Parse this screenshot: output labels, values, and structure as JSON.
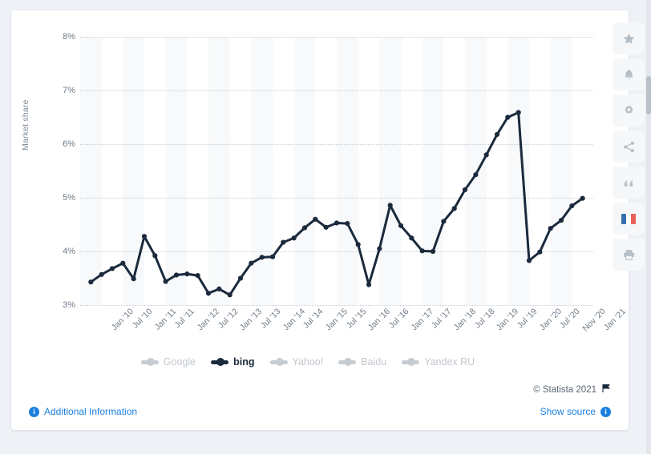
{
  "chart_data": {
    "type": "line",
    "title": "",
    "xlabel": "",
    "ylabel": "Market share",
    "ylim": [
      3,
      8
    ],
    "yticks": [
      "3%",
      "4%",
      "5%",
      "6%",
      "7%",
      "8%"
    ],
    "ytick_values": [
      3,
      4,
      5,
      6,
      7,
      8
    ],
    "grid": true,
    "legend_position": "bottom",
    "legend": [
      "Google",
      "bing",
      "Yahoo!",
      "Baidu",
      "Yandex RU"
    ],
    "active_series": "bing",
    "x_tick_labels": [
      "Jan '10",
      "Jul '10",
      "Jan '11",
      "Jul '11",
      "Jan '12",
      "Jul '12",
      "Jan '13",
      "Jul '13",
      "Jan '14",
      "Jul '14",
      "Jan '15",
      "Jul '15",
      "Jan '16",
      "Jul '16",
      "Jan '17",
      "Jul '17",
      "Jan '18",
      "Jul '18",
      "Jan '19",
      "Jul '19",
      "Jan '20",
      "Jul '20",
      "Nov '20",
      "Jan '21"
    ],
    "series": [
      {
        "name": "bing",
        "color": "#1b2a3d",
        "x": [
          "Jan '10",
          "Apr '10",
          "Jul '10",
          "Oct '10",
          "Jan '11",
          "Apr '11",
          "Jul '11",
          "Oct '11",
          "Jan '12",
          "Apr '12",
          "Jul '12",
          "Oct '12",
          "Jan '13",
          "Apr '13",
          "Jul '13",
          "Oct '13",
          "Jan '14",
          "Apr '14",
          "Jul '14",
          "Oct '14",
          "Jan '15",
          "Apr '15",
          "Jul '15",
          "Oct '15",
          "Jan '16",
          "Apr '16",
          "Jul '16",
          "Oct '16",
          "Jan '17",
          "Apr '17",
          "Jul '17",
          "Oct '17",
          "Jan '18",
          "Apr '18",
          "Jul '18",
          "Oct '18",
          "Jan '19",
          "Apr '19",
          "Jul '19",
          "Oct '19",
          "Jan '20",
          "Apr '20",
          "Jul '20",
          "Sep '20",
          "Nov '20",
          "Dec '20",
          "Jan '21"
        ],
        "values": [
          3.43,
          3.57,
          3.68,
          3.78,
          3.49,
          4.28,
          3.92,
          3.44,
          3.56,
          3.58,
          3.55,
          3.22,
          3.3,
          3.19,
          3.5,
          3.78,
          3.89,
          3.9,
          4.17,
          4.25,
          4.44,
          4.6,
          4.45,
          4.53,
          4.52,
          4.13,
          3.38,
          4.05,
          4.86,
          4.48,
          4.25,
          4.01,
          4.0,
          4.56,
          4.8,
          5.15,
          5.43,
          5.8,
          6.18,
          6.5,
          6.59,
          3.83,
          3.99,
          4.43,
          4.58,
          4.85,
          4.99
        ]
      }
    ],
    "bing_values_note": "market share percentages"
  },
  "legend_items": [
    {
      "label": "Google",
      "active": false
    },
    {
      "label": "bing",
      "active": true
    },
    {
      "label": "Yahoo!",
      "active": false
    },
    {
      "label": "Baidu",
      "active": false
    },
    {
      "label": "Yandex RU",
      "active": false
    }
  ],
  "footer": {
    "copyright": "© Statista 2021",
    "flag_icon": "flag-icon",
    "additional_information": "Additional Information",
    "additional_information_icon": "info-icon",
    "show_source": "Show source",
    "show_source_icon": "info-icon"
  },
  "toolbar": {
    "items": [
      {
        "name": "star-icon",
        "tooltip": "Favorite"
      },
      {
        "name": "bell-icon",
        "tooltip": "Notifications"
      },
      {
        "name": "gear-icon",
        "tooltip": "Settings"
      },
      {
        "name": "share-icon",
        "tooltip": "Share"
      },
      {
        "name": "quote-icon",
        "tooltip": "Cite"
      },
      {
        "name": "french-flag-icon",
        "tooltip": "Language"
      },
      {
        "name": "print-icon",
        "tooltip": "Print"
      }
    ]
  },
  "colors": {
    "series_active": "#1b2a3d",
    "series_inactive": "#c6ccd2",
    "link": "#1b7fe0",
    "page_bg": "#eef1f5",
    "card_bg": "#ffffff",
    "band": "#f8f9fa",
    "axis_text": "#6f7b88"
  }
}
